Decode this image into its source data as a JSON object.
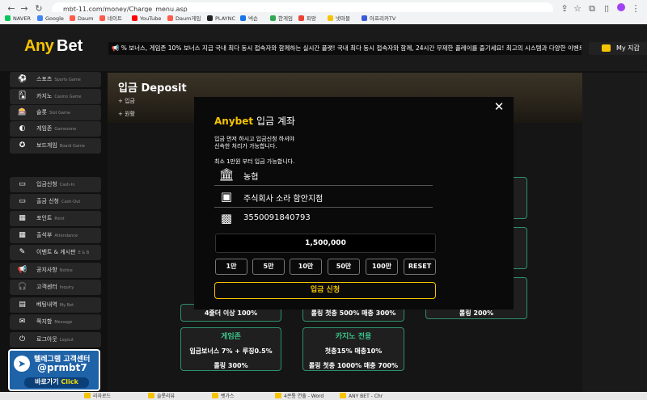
{
  "browser": {
    "url": "mbt-11.com/money/Charge_menu.asp",
    "bookmarks": [
      {
        "label": "NAVER",
        "color": "#03c75a"
      },
      {
        "label": "Google",
        "color": "#4285f4"
      },
      {
        "label": "Daum",
        "color": "#ff5a4a"
      },
      {
        "label": "네이트",
        "color": "#ff5a4a"
      },
      {
        "label": "YouTube",
        "color": "#ff0000"
      },
      {
        "label": "Daum게임",
        "color": "#ff5a4a"
      },
      {
        "label": "PLAYNC",
        "color": "#222222"
      },
      {
        "label": "넥슨",
        "color": "#1a73e8"
      },
      {
        "label": "한게임",
        "color": "#34a853"
      },
      {
        "label": "피망",
        "color": "#ea4335"
      },
      {
        "label": "넷마블",
        "color": "#f5c400"
      },
      {
        "label": "아프리카TV",
        "color": "#3b5bdb"
      }
    ]
  },
  "site": {
    "logo_any": "Any",
    "logo_bet": "Bet",
    "ticker": "📢 % 보너스, 게임존 10% 보너스 지급 국내 최다 동시 접속자와 함께하는 실시간 플랫! 국내 최다 동시 접속자와 함께, 24시간 무제한 플레이를 즐기세요! 최고의 시스템과 다양한 이벤트로 언제 어디서나 일...",
    "wallet": "My 지갑"
  },
  "sidebar": {
    "games": [
      {
        "icon": "⚽",
        "label": "스포츠",
        "sub": "Sports Game"
      },
      {
        "icon": "🂡",
        "label": "카지노",
        "sub": "Casino Game"
      },
      {
        "icon": "🎰",
        "label": "슬롯",
        "sub": "Slot Game"
      },
      {
        "icon": "◐",
        "label": "게임존",
        "sub": "Gamezone"
      },
      {
        "icon": "✪",
        "label": "보드게임",
        "sub": "Board Game"
      }
    ],
    "menu": [
      {
        "icon": "▭",
        "label": "입금신청",
        "sub": "Cash-In"
      },
      {
        "icon": "▭",
        "label": "출금 신청",
        "sub": "Cash-Out"
      },
      {
        "icon": "▦",
        "label": "포인트",
        "sub": "Point"
      },
      {
        "icon": "▦",
        "label": "출석부",
        "sub": "Attendance"
      },
      {
        "icon": "✎",
        "label": "이벤트 & 게시판",
        "sub": "E & B"
      },
      {
        "icon": "📢",
        "label": "공지사항",
        "sub": "Notice"
      },
      {
        "icon": "🎧",
        "label": "고객센터",
        "sub": "Inquiry"
      },
      {
        "icon": "▤",
        "label": "베팅내역",
        "sub": "My Bet"
      },
      {
        "icon": "✉",
        "label": "쪽지함",
        "sub": "Message"
      },
      {
        "icon": "⏻",
        "label": "로그아웃",
        "sub": "Logout"
      }
    ],
    "telegram": {
      "line1": "텔레그램 고객센터",
      "line2": "@prmbt7",
      "button_go": "바로가기",
      "button_click": "Click"
    }
  },
  "main": {
    "title": "입금 Deposit",
    "crumb1": "+ 입금",
    "crumb2": "+ 원활",
    "cards": [
      {
        "title": "",
        "line1": "4줄더 이상 100%",
        "line2": ""
      },
      {
        "title": "",
        "line1": "롤링 첫충 500% 매충 300%",
        "line2": ""
      },
      {
        "title": "",
        "line1": "롤링 200%",
        "line2": ""
      },
      {
        "title": "게임존",
        "line1": "입금보너스 7% + 루징0.5%",
        "line2": "롤링 300%"
      },
      {
        "title": "카지노 전용",
        "line1": "첫충15% 매충10%",
        "line2": "롤링 첫충 1000% 매충 700%"
      }
    ]
  },
  "modal": {
    "brand": "Anybet",
    "title_rest": " 입금 계좌",
    "note1": "입금 먼저 하시고 입금신청 하셔야",
    "note2": "신속한 처리가 가능합니다.",
    "note3": "최소 1만원 부터 입금 가능합니다.",
    "bank": "농협",
    "holder": "주식회사 소라 함안지점",
    "account": "3550091840793",
    "amount": "1,500,000",
    "amounts": [
      "1만",
      "5만",
      "10만",
      "50만",
      "100만",
      "RESET"
    ],
    "submit": "입금 신청",
    "close": "✕"
  },
  "taskbar": [
    "리자로드",
    "슬롯리뷰",
    "벳가스",
    "4콘통 연출 - Word",
    "ANY BET - Chr"
  ]
}
